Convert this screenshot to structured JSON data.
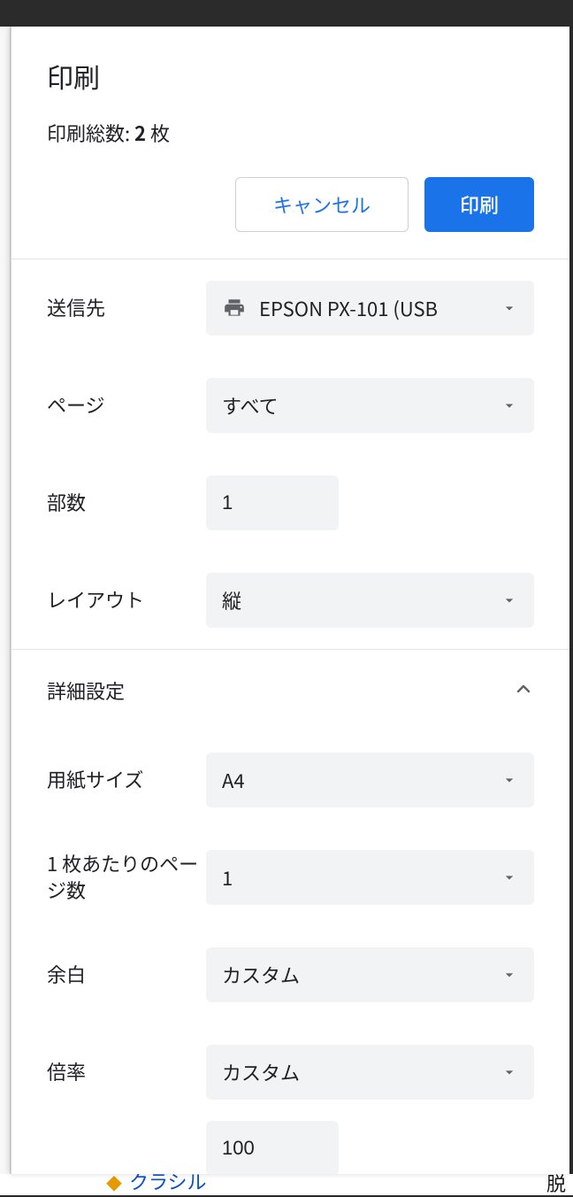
{
  "header": {
    "title": "印刷",
    "summary_prefix": "印刷総数: ",
    "summary_count": "2",
    "summary_suffix": " 枚"
  },
  "buttons": {
    "cancel": "キャンセル",
    "print": "印刷"
  },
  "fields": {
    "destination": {
      "label": "送信先",
      "value": "EPSON PX-101 (USB"
    },
    "pages": {
      "label": "ページ",
      "value": "すべて"
    },
    "copies": {
      "label": "部数",
      "value": "1"
    },
    "layout": {
      "label": "レイアウト",
      "value": "縦"
    }
  },
  "more": {
    "header": "詳細設定",
    "paper_size": {
      "label": "用紙サイズ",
      "value": "A4"
    },
    "pages_per_sheet": {
      "label": "1 枚あたりのページ数",
      "value": "1"
    },
    "margins": {
      "label": "余白",
      "value": "カスタム"
    },
    "scale": {
      "label": "倍率",
      "value": "カスタム",
      "custom_value": "100"
    }
  },
  "background": {
    "bottom_text": "クラシル",
    "right_text": "脱"
  }
}
